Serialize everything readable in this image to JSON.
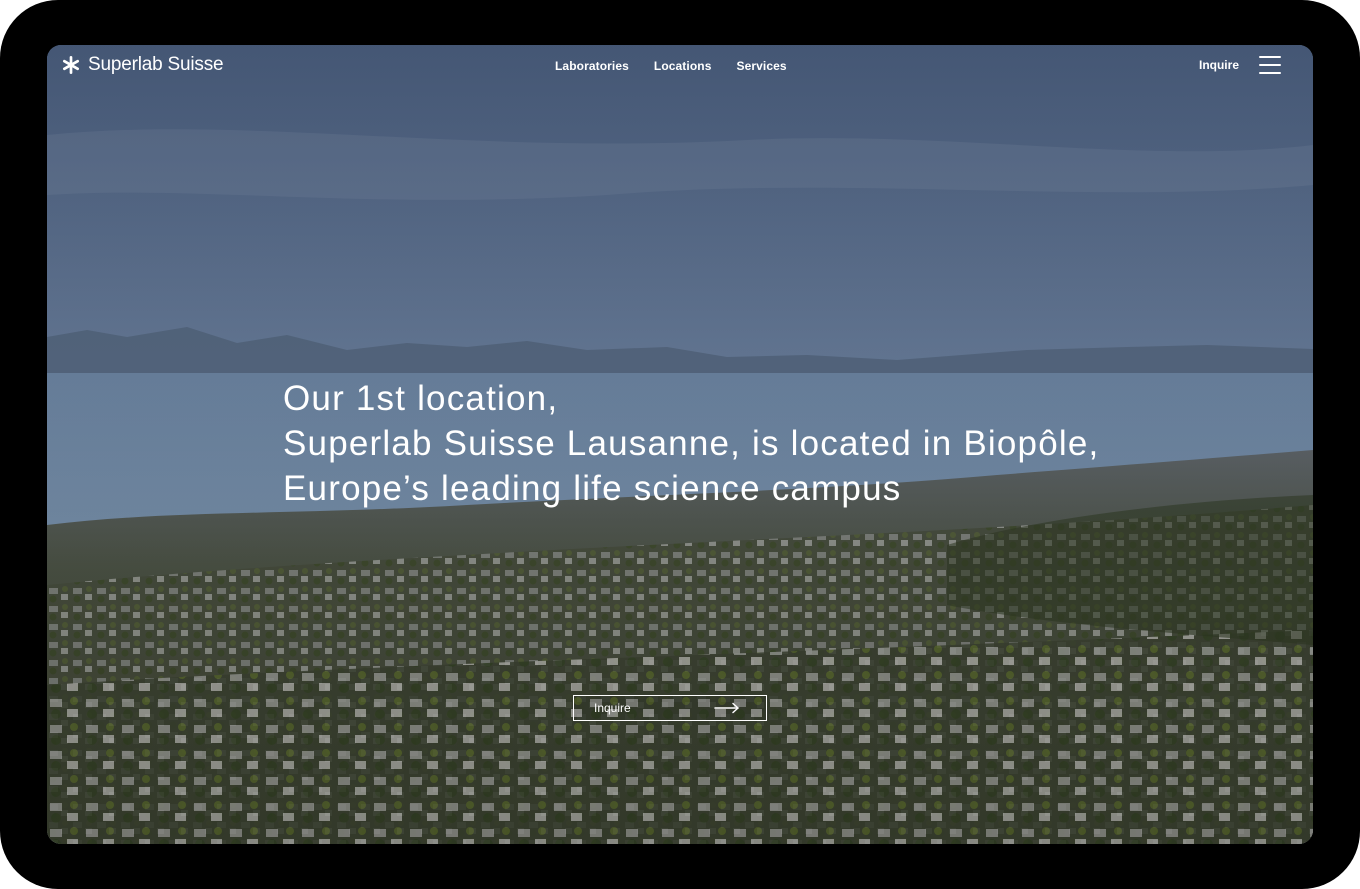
{
  "brand": {
    "name": "Superlab Suisse",
    "logo_icon": "asterisk-icon"
  },
  "nav": {
    "items": [
      {
        "label": "Laboratories"
      },
      {
        "label": "Locations"
      },
      {
        "label": "Services"
      }
    ]
  },
  "header": {
    "inquire_label": "Inquire",
    "menu_icon": "hamburger-menu-icon"
  },
  "hero": {
    "headline_lines": [
      "Our 1st location,",
      "Superlab Suisse Lausanne, is located in Biopôle,",
      "Europe’s leading life science campus"
    ],
    "cta_label": "Inquire",
    "cta_icon": "arrow-right-icon"
  },
  "colors": {
    "device_frame": "#000000",
    "text": "#ffffff",
    "sky": "#5b6c85",
    "lake": "#6d87a3",
    "forest": "#3d4630"
  }
}
